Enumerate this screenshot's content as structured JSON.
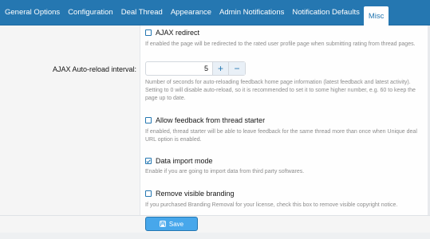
{
  "tabs": [
    {
      "label": "General Options"
    },
    {
      "label": "Configuration"
    },
    {
      "label": "Deal Thread"
    },
    {
      "label": "Appearance"
    },
    {
      "label": "Admin Notifications"
    },
    {
      "label": "Notification Defaults"
    },
    {
      "label": "Misc",
      "active": true
    }
  ],
  "options": {
    "ajax_redirect": {
      "label": "AJAX redirect",
      "checked": false,
      "description": "If enabled the page will be redirected to the rated user profile page when submitting rating from thread pages."
    },
    "auto_reload": {
      "label": "AJAX Auto-reload interval:",
      "value": "5",
      "plus": "+",
      "minus": "−",
      "description": "Number of seconds for auto-reloading feedback home page information (latest feedback and latest activity). Setting to 0 will disable auto-reload, so it is recommended to set it to some higher number, e.g. 60 to keep the page up to date."
    },
    "feedback_thread_starter": {
      "label": "Allow feedback from thread starter",
      "checked": false,
      "description": "If enabled, thread starter will be able to leave feedback for the same thread more than once when Unique deal URL option is enabled."
    },
    "data_import": {
      "label": "Data import mode",
      "checked": true,
      "description": "Enable if you are going to import data from third party softwares."
    },
    "remove_branding": {
      "label": "Remove visible branding",
      "checked": false,
      "description": "If you purchased Branding Removal for your license, check this box to remove visible copyright notice."
    }
  },
  "footer": {
    "save_label": "Save",
    "save_icon": "save-icon"
  },
  "colors": {
    "accent": "#2577b1",
    "button": "#47a7eb",
    "muted_text": "#8c8c8c"
  }
}
